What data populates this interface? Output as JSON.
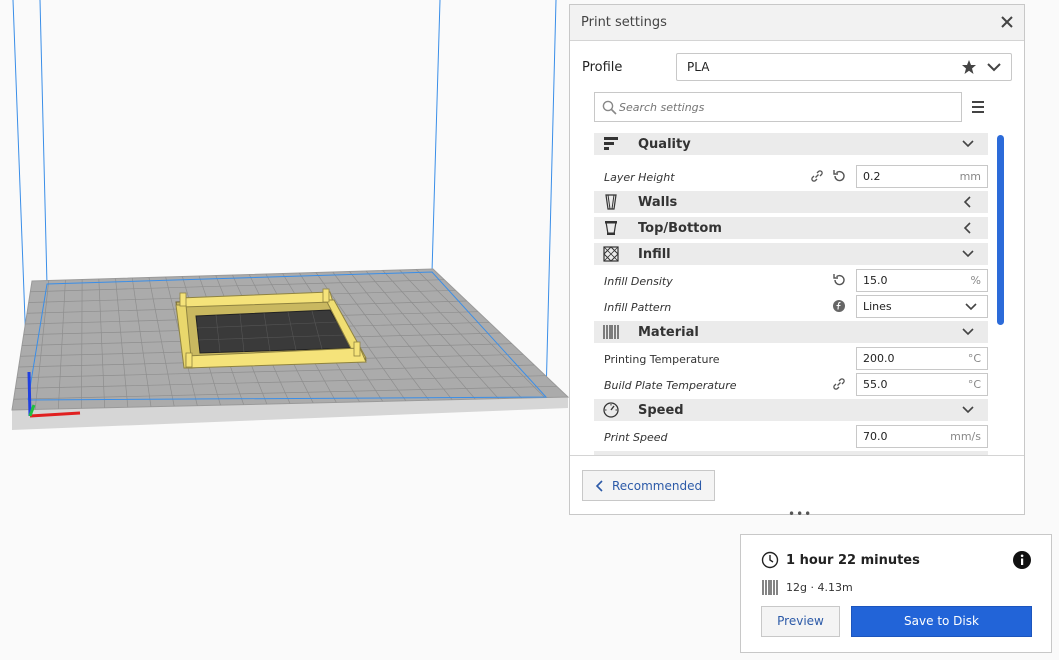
{
  "print_settings": {
    "title": "Print settings",
    "profile_label": "Profile",
    "profile_value": "PLA",
    "search_placeholder": "Search settings",
    "categories": {
      "quality": "Quality",
      "walls": "Walls",
      "top_bottom": "Top/Bottom",
      "infill": "Infill",
      "material": "Material",
      "speed": "Speed"
    },
    "settings": {
      "layer_height": {
        "label": "Layer Height",
        "value": "0.2",
        "unit": "mm"
      },
      "infill_density": {
        "label": "Infill Density",
        "value": "15.0",
        "unit": "%"
      },
      "infill_pattern": {
        "label": "Infill Pattern",
        "value": "Lines"
      },
      "printing_temperature": {
        "label": "Printing Temperature",
        "value": "200.0",
        "unit": "°C"
      },
      "build_plate_temperature": {
        "label": "Build Plate Temperature",
        "value": "55.0",
        "unit": "°C"
      },
      "print_speed": {
        "label": "Print Speed",
        "value": "70.0",
        "unit": "mm/s"
      }
    },
    "recommended_label": "Recommended",
    "drag_handle": "•••"
  },
  "job": {
    "time": "1 hour 22 minutes",
    "material": "12g · 4.13m",
    "preview_label": "Preview",
    "save_label": "Save to Disk"
  },
  "colors": {
    "accent": "#2264d8",
    "model": "#f5e37a",
    "grid_line": "#8a8a8a",
    "volume_edge": "#3a8ee8"
  }
}
